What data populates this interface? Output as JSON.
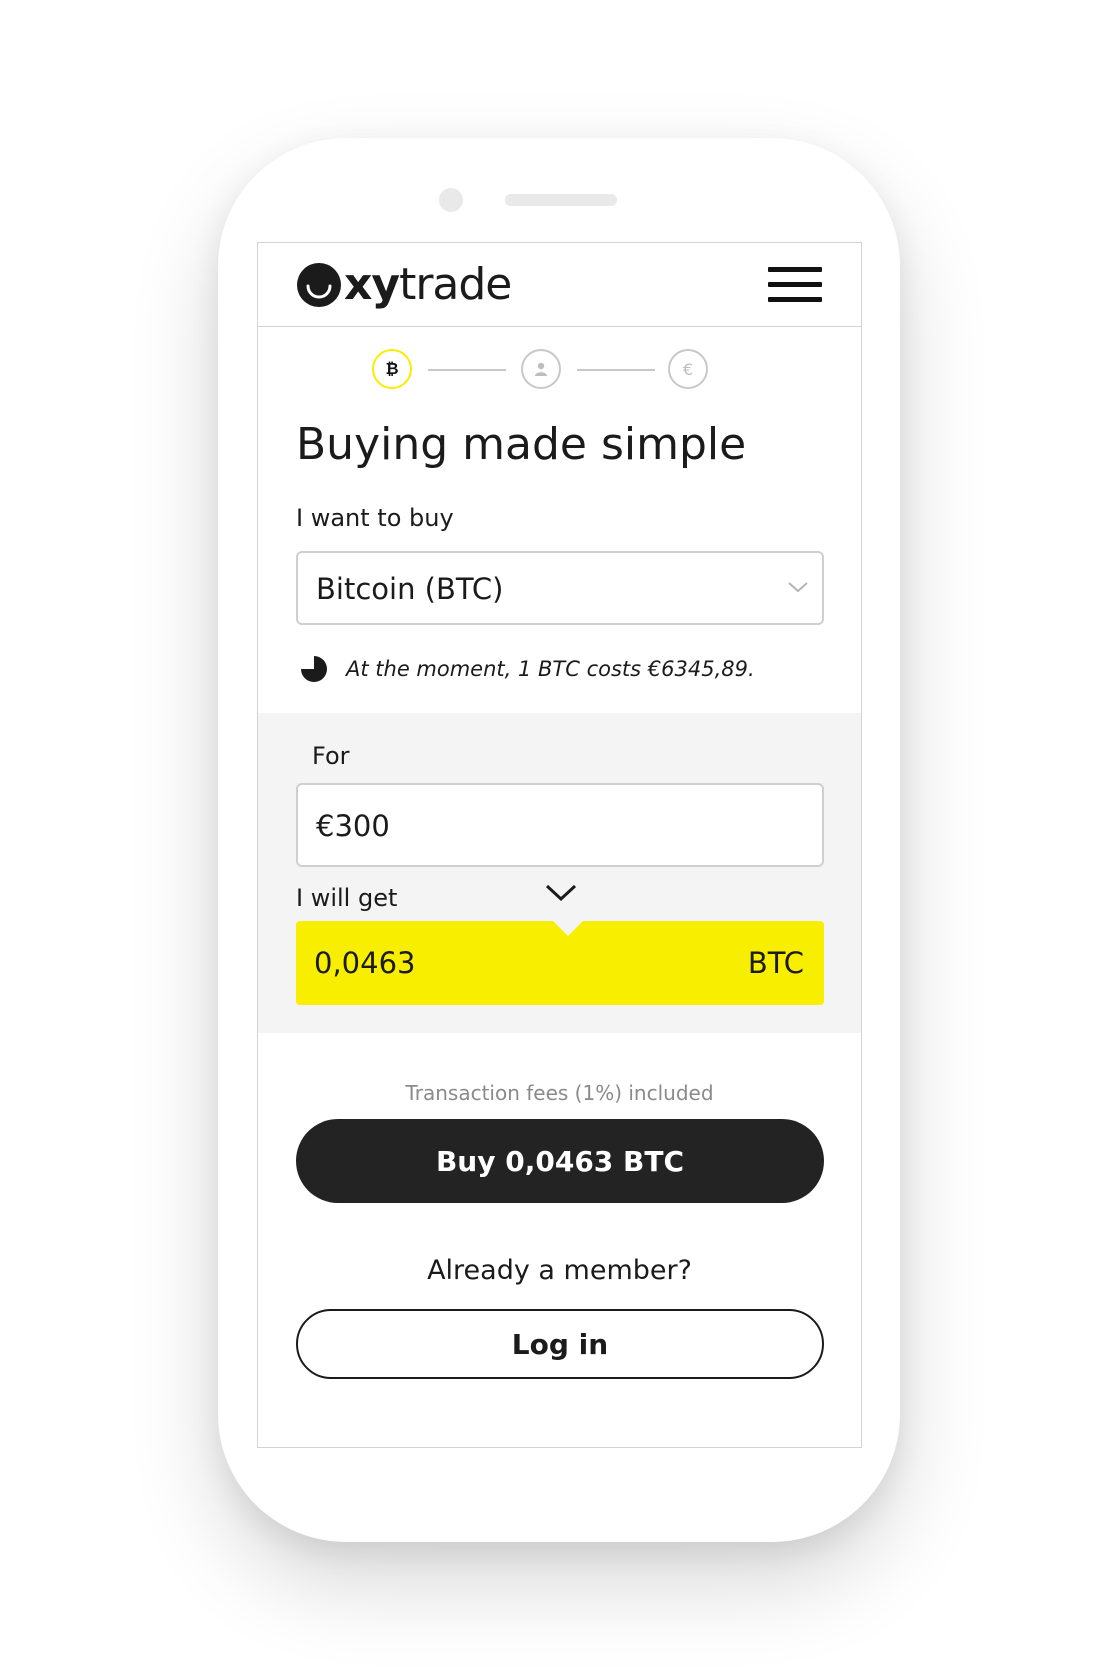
{
  "brand": {
    "name_bold": "xy",
    "name_regular": "trade",
    "accent_color": "#f8ee00"
  },
  "header": {
    "menu_icon": "hamburger-menu-icon"
  },
  "steps": [
    {
      "icon": "bitcoin-icon",
      "glyph": "₿",
      "active": true
    },
    {
      "icon": "user-icon",
      "glyph": "",
      "active": false
    },
    {
      "icon": "euro-icon",
      "glyph": "€",
      "active": false
    }
  ],
  "main": {
    "title": "Buying made simple",
    "buy_label": "I want to buy",
    "selected_asset": "Bitcoin (BTC)",
    "rate_text": "At the moment, 1 BTC costs €6345,89."
  },
  "calculator": {
    "for_label": "For",
    "amount_value": "€300",
    "get_label": "I will get",
    "result_value": "0,0463",
    "result_unit": "BTC"
  },
  "footer": {
    "fees_note": "Transaction fees (1%) included",
    "buy_button": "Buy 0,0463 BTC",
    "member_question": "Already a member?",
    "login_button": "Log in"
  }
}
